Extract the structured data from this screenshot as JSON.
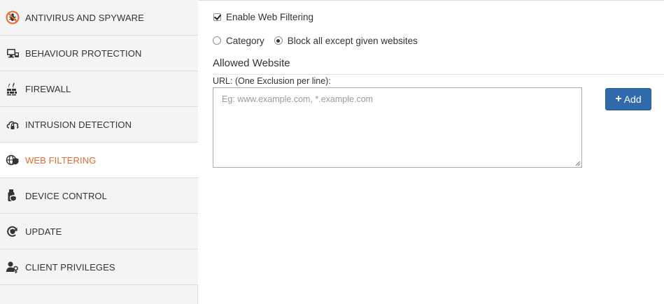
{
  "colors": {
    "accent": "#e46a2d",
    "button": "#2f6aad"
  },
  "sidebar": {
    "items": [
      {
        "label": "ANTIVIRUS AND SPYWARE",
        "icon": "bug-block-icon",
        "active": false
      },
      {
        "label": "BEHAVIOUR PROTECTION",
        "icon": "monitor-network-icon",
        "active": false
      },
      {
        "label": "FIREWALL",
        "icon": "firewall-icon",
        "active": false
      },
      {
        "label": "INTRUSION DETECTION",
        "icon": "cloud-lock-icon",
        "active": false
      },
      {
        "label": "WEB FILTERING",
        "icon": "globe-shield-icon",
        "active": true
      },
      {
        "label": "DEVICE CONTROL",
        "icon": "usb-shield-icon",
        "active": false
      },
      {
        "label": "UPDATE",
        "icon": "refresh-shield-icon",
        "active": false
      },
      {
        "label": "CLIENT PRIVILEGES",
        "icon": "user-key-icon",
        "active": false
      }
    ]
  },
  "main": {
    "enable_label": "Enable Web Filtering",
    "enable_checked": true,
    "mode_options": [
      {
        "label": "Category",
        "selected": false
      },
      {
        "label": "Block all except given websites",
        "selected": true
      }
    ],
    "section_title": "Allowed Website",
    "url_label": "URL: (One Exclusion per line):",
    "url_placeholder": "Eg: www.example.com, *.example.com",
    "add_button": "Add"
  }
}
